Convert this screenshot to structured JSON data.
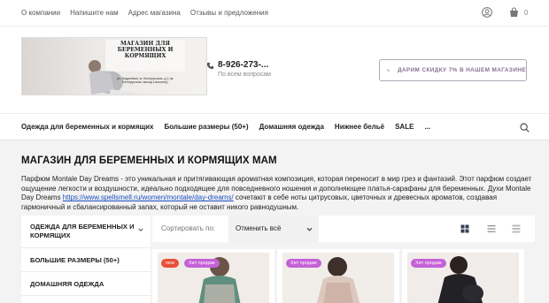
{
  "top_nav": {
    "links": [
      "О компании",
      "Напишите нам",
      "Адрес магазина",
      "Отзывы и предложения"
    ],
    "cart_count": "0"
  },
  "header": {
    "banner_title": "МАГАЗИН ДЛЯ БЕРЕМЕННЫХ И КОРМЯЩИХ",
    "banner_address": "ул. Андреевка, м. Белорусская, д.1 (м. Белорусская, выход к вокзалу)",
    "phone": "8-926-273-...",
    "phone_caption": "По всем вопросам",
    "promo_label": "ДАРИМ СКИДКУ 7% В НАШЕМ МАГАЗИНЕ"
  },
  "category_nav": {
    "items": [
      "Одежда для беременных и кормящих",
      "Большие размеры (50+)",
      "Домашняя одежда",
      "Нижнее бельё",
      "SALE",
      "..."
    ]
  },
  "main": {
    "title": "МАГАЗИН ДЛЯ БЕРЕМЕННЫХ И КОРМЯЩИХ МАМ",
    "desc_before_link": "Парфюм Montale Day Dreams - это уникальная и притягивающая ароматная композиция, которая переносит в мир грез и фантазий. Этот парфюм создает ощущение легкости и воздушности, идеально подходящее для повседневного ношения и дополняющее платья-сарафаны для беременных. Духи Montale Day Dreams ",
    "desc_link": "https://www.spellsmell.ru/women/montale/day-dreams/",
    "desc_after_link": " сочетают в себе ноты цитрусовых, цветочных и древесных ароматов, создавая гармоничный и сбалансированный запах, который не оставит никого равнодушным."
  },
  "sidebar": {
    "items": [
      "ОДЕЖДА ДЛЯ БЕРЕМЕННЫХ И КОРМЯЩИХ",
      "БОЛЬШИЕ РАЗМЕРЫ (50+)",
      "ДОМАШНЯЯ ОДЕЖДА"
    ]
  },
  "sort": {
    "label": "Сортировать по:",
    "value": "Отменить всё"
  },
  "products": [
    {
      "badges": [
        "new",
        "Хит продаж"
      ]
    },
    {
      "badges": [
        "Хит продаж"
      ]
    },
    {
      "badges": [
        "Хит продаж"
      ]
    }
  ],
  "colors": {
    "accent": "#8a6f92",
    "badge_new": "#e8503a",
    "badge_hit": "#c561d8",
    "link": "#1a4fc2"
  }
}
